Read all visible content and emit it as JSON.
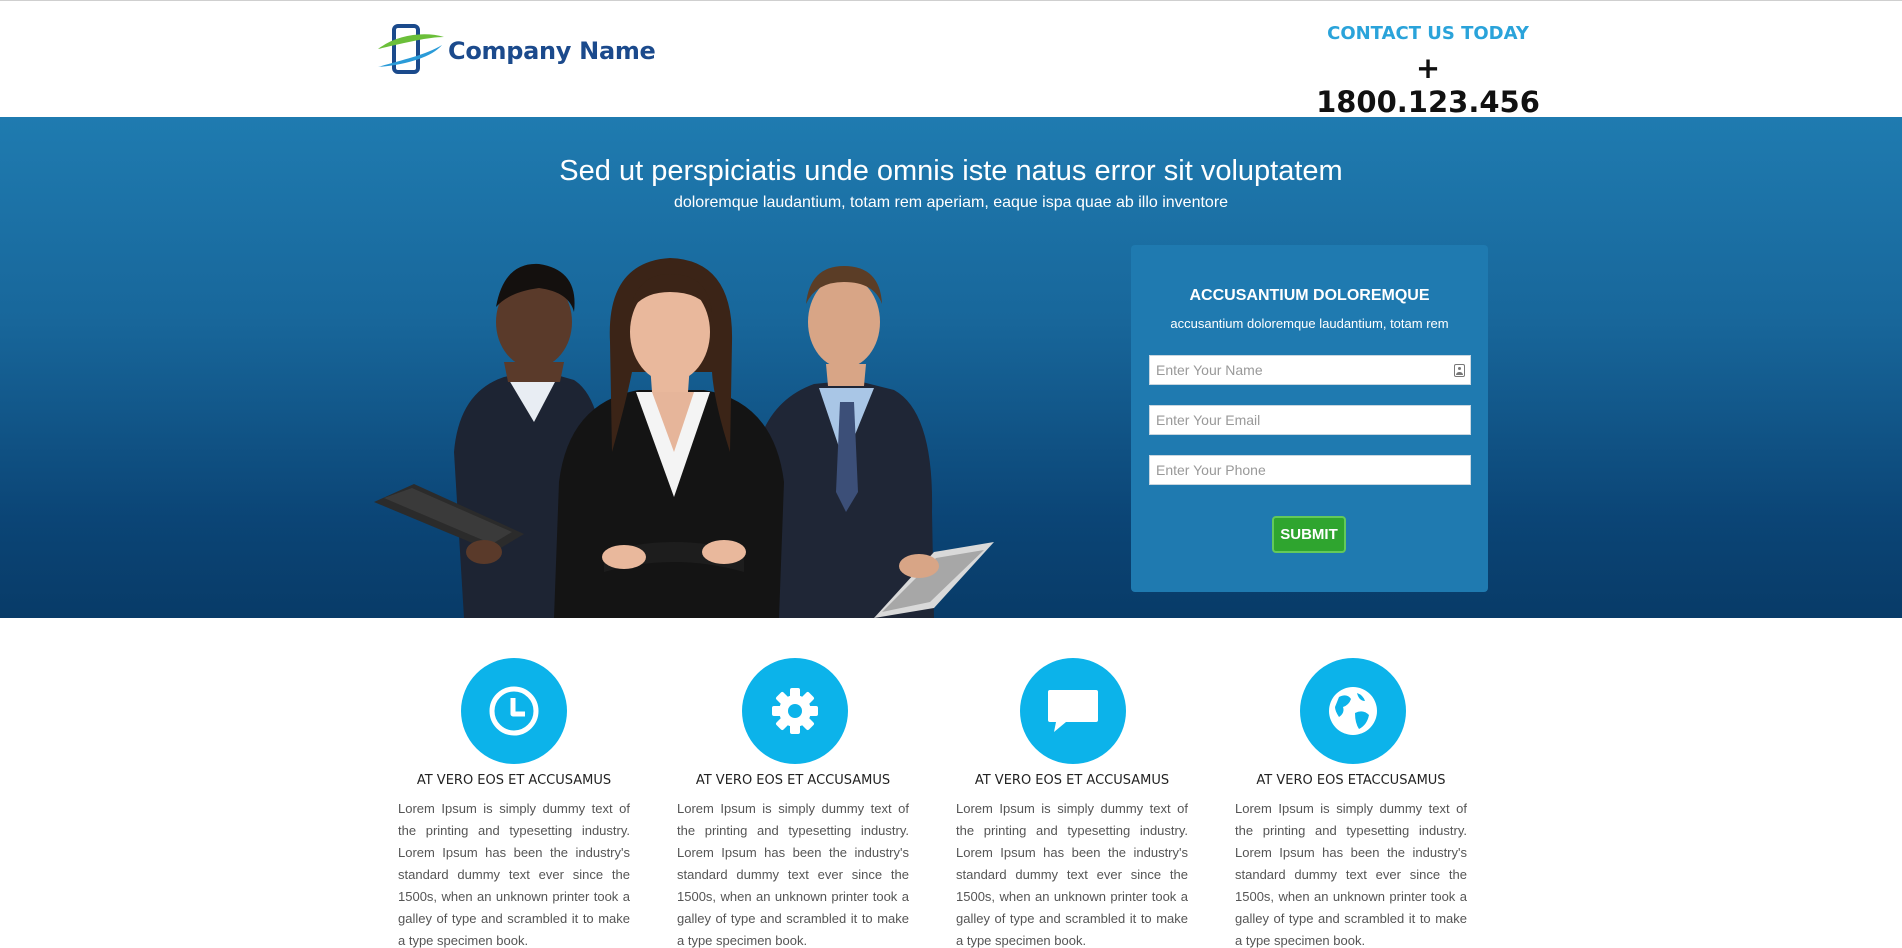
{
  "header": {
    "company_name": "Company Name",
    "contact_label": "CONTACT US TODAY",
    "phone": "+ 1800.123.456"
  },
  "hero": {
    "title": "Sed ut perspiciatis unde omnis iste natus error sit voluptatem",
    "subtitle": "doloremque laudantium, totam rem aperiam, eaque ispa quae ab illo inventore"
  },
  "form": {
    "title": "ACCUSANTIUM DOLOREMQUE",
    "subtitle": "accusantium doloremque laudantium, totam rem",
    "name_placeholder": "Enter Your Name",
    "email_placeholder": "Enter Your Email",
    "phone_placeholder": "Enter Your Phone",
    "submit_label": "SUBMIT"
  },
  "features": [
    {
      "icon": "clock-icon",
      "title": "AT VERO EOS ET ACCUSAMUS",
      "text": "Lorem Ipsum is simply dummy text of the printing and typesetting industry. Lorem Ipsum has been the industry's standard dummy text ever since the 1500s, when an unknown printer took a galley of type and scrambled it to make a type specimen book."
    },
    {
      "icon": "gear-icon",
      "title": "AT VERO EOS ET ACCUSAMUS",
      "text": "Lorem Ipsum is simply dummy text of the printing and typesetting industry. Lorem Ipsum has been the industry's standard dummy text ever since the 1500s, when an unknown printer took a galley of type and scrambled it to make a type specimen book."
    },
    {
      "icon": "chat-icon",
      "title": "AT VERO EOS ET ACCUSAMUS",
      "text": "Lorem Ipsum is simply dummy text of the printing and typesetting industry. Lorem Ipsum has been the industry's standard dummy text ever since the 1500s, when an unknown printer took a galley of type and scrambled it to make a type specimen book."
    },
    {
      "icon": "globe-icon",
      "title": "AT VERO EOS ETACCUSAMUS",
      "text": "Lorem Ipsum is simply dummy text of the printing and typesetting industry. Lorem Ipsum has been the industry's standard dummy text ever since the 1500s, when an unknown printer took a galley of type and scrambled it to make a type specimen book."
    }
  ],
  "colors": {
    "brand": "#1b4a8c",
    "accent": "#2aa3da",
    "hero_top": "#1f7bb0",
    "hero_bottom": "#083b68",
    "icon_circle": "#0cb3ea",
    "submit": "#2fa52f"
  }
}
